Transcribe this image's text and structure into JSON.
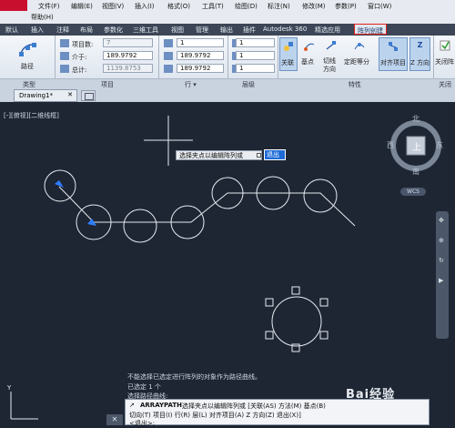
{
  "menubar": {
    "items": [
      "文件(F)",
      "编辑(E)",
      "视图(V)",
      "插入(I)",
      "格式(O)",
      "工具(T)",
      "绘图(D)",
      "标注(N)",
      "修改(M)",
      "参数(P)",
      "窗口(W)"
    ],
    "help": "帮助(H)"
  },
  "ribbon_tabs": [
    "默认",
    "插入",
    "注释",
    "布局",
    "参数化",
    "三维工具",
    "视图",
    "管理",
    "输出",
    "插件",
    "Autodesk 360",
    "精选应用",
    "阵列创建"
  ],
  "ribbon": {
    "type_button": "路径",
    "items_count_label": "项目数:",
    "items_count_value": "7",
    "between_label": "介于:",
    "between_value": "189.9792",
    "total_label": "总计:",
    "total_value": "1139.8753",
    "rows_value": "1",
    "row_between_value": "189.9792",
    "row_total_value": "189.9792",
    "level_value": "1",
    "level_between_value": "1",
    "level_total_value": "1",
    "associative": "关联",
    "base_point": "基点",
    "tangent_direction": "切线\n方向",
    "measure": "定距等分",
    "align_items": "对齐项目",
    "z_direction": "Z 方向",
    "close_array": "关闭阵"
  },
  "ribbon_footer": [
    "类型",
    "项目",
    "行 ▾",
    "层级",
    "特性",
    "关闭"
  ],
  "doc_tab": "Drawing1*",
  "view_label": "[-][俯视][二维线框]",
  "prompt": {
    "text": "选择夹点以编辑阵列或",
    "input": "退出"
  },
  "viewcube": {
    "north": "北",
    "south": "南",
    "east": "东",
    "west": "西",
    "top": "上",
    "wcs": "WCS"
  },
  "history": [
    "不能选择已选定进行阵列的对象作为路径曲线。",
    "已选定 1 个",
    "选择路径曲线:"
  ],
  "command": {
    "name": "ARRAYPATH",
    "line1": "选择夹点以编辑阵列或 [关联(AS) 方法(M) 基点(B)",
    "line2": "切向(T) 项目(I) 行(R) 层(L) 对齐项目(A) Z 方向(Z) 退出(X)]",
    "line3": "<退出>:"
  },
  "watermark": "Bai经验"
}
